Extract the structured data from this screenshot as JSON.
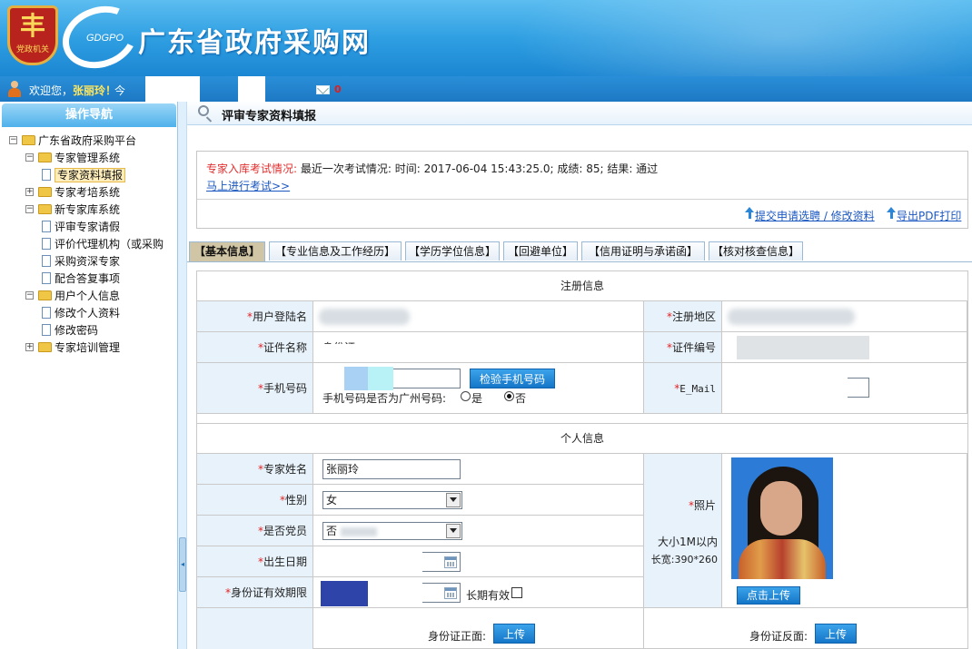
{
  "header": {
    "emblem_text": "党政机关",
    "logo_abbr": "GDGPO",
    "site_title": "广东省政府采购网"
  },
  "welcome": {
    "greeting": "欢迎您，",
    "user_name": "张丽玲！",
    "after": "今",
    "mail_count": "0"
  },
  "sidebar": {
    "title": "操作导航",
    "tree": [
      {
        "label": "广东省政府采购平台",
        "level": 0,
        "type": "folder",
        "expander": "−"
      },
      {
        "label": "专家管理系统",
        "level": 1,
        "type": "folder",
        "expander": "−"
      },
      {
        "label": "专家资料填报",
        "level": 2,
        "type": "doc",
        "selected": true
      },
      {
        "label": "专家考培系统",
        "level": 1,
        "type": "folder",
        "expander": "+"
      },
      {
        "label": "新专家库系统",
        "level": 1,
        "type": "folder",
        "expander": "−"
      },
      {
        "label": "评审专家请假",
        "level": 2,
        "type": "doc"
      },
      {
        "label": "评价代理机构（或采购",
        "level": 2,
        "type": "doc"
      },
      {
        "label": "采购资深专家",
        "level": 2,
        "type": "doc"
      },
      {
        "label": "配合答复事项",
        "level": 2,
        "type": "doc"
      },
      {
        "label": "用户个人信息",
        "level": 1,
        "type": "folder",
        "expander": "−"
      },
      {
        "label": "修改个人资料",
        "level": 2,
        "type": "doc"
      },
      {
        "label": "修改密码",
        "level": 2,
        "type": "doc"
      },
      {
        "label": "专家培训管理",
        "level": 1,
        "type": "folder",
        "expander": "+"
      }
    ]
  },
  "page": {
    "title": "评审专家资料填报",
    "exam": {
      "label": "专家入库考试情况:",
      "info": "最近一次考试情况:  时间: 2017-06-04 15:43:25.0; 成绩: 85; 结果: 通过",
      "link": "马上进行考试>>"
    },
    "actions": {
      "submit": "提交申请选聘 / 修改资料",
      "export": "导出PDF打印"
    },
    "tabs": [
      {
        "label": "【基本信息】",
        "active": true
      },
      {
        "label": "【专业信息及工作经历】"
      },
      {
        "label": "【学历学位信息】"
      },
      {
        "label": "【回避单位】"
      },
      {
        "label": "【信用证明与承诺函】"
      },
      {
        "label": "【核对核查信息】"
      }
    ]
  },
  "form": {
    "required_mark": "*",
    "reg_section": "注册信息",
    "login_name_label": "用户登陆名",
    "reg_region_label": "注册地区",
    "cert_name_label": "证件名称",
    "cert_name_value": "身份证",
    "cert_no_label": "证件编号",
    "phone_label": "手机号码",
    "verify_phone_btn": "检验手机号码",
    "guangzhou_q": "手机号码是否为广州号码:",
    "yes": "是",
    "no": "否",
    "email_label": "E_Mail",
    "personal_section": "个人信息",
    "name_label": "专家姓名",
    "name_value": "张丽玲",
    "gender_label": "性别",
    "gender_value": "女",
    "party_label": "是否党员",
    "party_value": "否",
    "birth_label": "出生日期",
    "id_valid_label": "身份证有效期限",
    "long_term": "长期有效",
    "photo_label": "照片",
    "photo_hint_size": "大小1M以内",
    "photo_hint_dims": "长宽:390*260",
    "upload_click": "点击上传",
    "id_front": "身份证正面:",
    "id_back": "身份证反面:",
    "upload": "上传"
  },
  "colors": {
    "banner": "#2f9fe2",
    "accent": "#1576c8",
    "label_bg": "#e8f2fb",
    "required": "#e02424",
    "link": "#1b57c0"
  }
}
